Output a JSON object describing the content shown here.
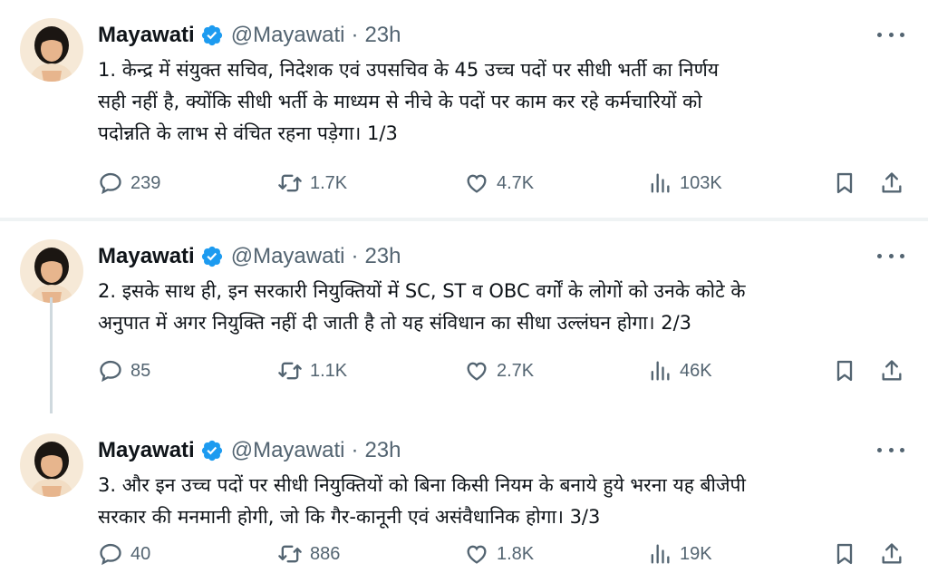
{
  "author": {
    "name": "Mayawati",
    "handle": "@Mayawati",
    "separator": "·",
    "verified_icon": "verified-badge-icon",
    "avatar_colors": {
      "hair": "#1b1612",
      "skin": "#e7b58d",
      "cloth": "#f2ddc4",
      "bg": "#f6e9d7"
    }
  },
  "accent": "#1d9bf0",
  "muted": "#536471",
  "tweets": [
    {
      "time": "23h",
      "lines": [
        "1. केन्द्र में संयुक्त सचिव, निदेशक एवं उपसचिव के 45 उच्च पदों पर सीधी भर्ती का निर्णय",
        "सही नहीं है, क्योंकि सीधी भर्ती के माध्यम से नीचे के पदों पर काम कर रहे कर्मचारियों को",
        "पदोन्नति के लाभ से वंचित रहना पड़ेगा। 1/3"
      ],
      "replies": "239",
      "reposts": "1.7K",
      "likes": "4.7K",
      "views": "103K"
    },
    {
      "time": "23h",
      "lines": [
        "2. इसके साथ ही, इन सरकारी नियुक्तियों में SC, ST व OBC वर्गों के लोगों को उनके कोटे के",
        "अनुपात में अगर नियुक्ति नहीं दी जाती है तो यह संविधान का सीधा उल्लंघन होगा। 2/3"
      ],
      "replies": "85",
      "reposts": "1.1K",
      "likes": "2.7K",
      "views": "46K"
    },
    {
      "time": "23h",
      "lines": [
        "3. और इन उच्च पदों पर सीधी नियुक्तियों को बिना किसी नियम के बनाये हुये भरना यह बीजेपी",
        "सरकार की मनमानी होगी, जो कि गैर-कानूनी एवं असंवैधानिक होगा। 3/3"
      ],
      "replies": "40",
      "reposts": "886",
      "likes": "1.8K",
      "views": "19K"
    }
  ],
  "icons": [
    "more-icon",
    "reply-icon",
    "repost-icon",
    "like-icon",
    "views-icon",
    "bookmark-icon",
    "share-icon"
  ]
}
